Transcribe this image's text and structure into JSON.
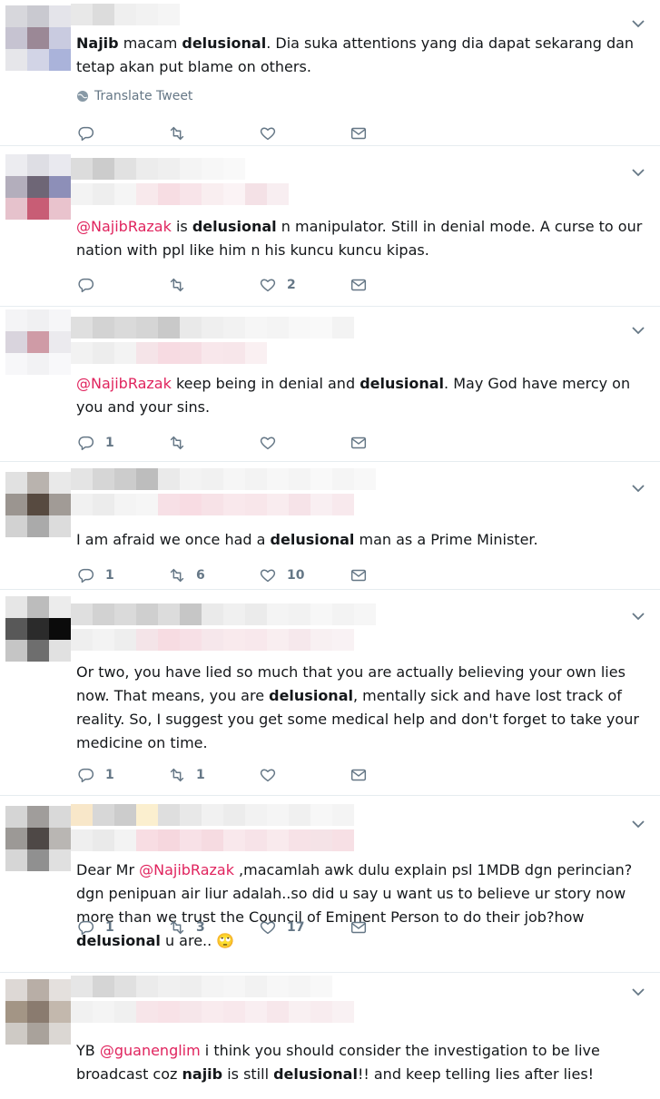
{
  "translate_label": "Translate Tweet",
  "colors": {
    "mention": "#e0245e",
    "icon": "#657786",
    "text": "#14171a"
  },
  "icons": {
    "reply": "reply-icon",
    "retweet": "retweet-icon",
    "like": "heart-icon",
    "dm": "envelope-icon",
    "menu": "chevron-down-icon",
    "translate": "globe-icon"
  },
  "tweets": [
    {
      "parts": [
        {
          "t": "Najib",
          "style": "b"
        },
        {
          "t": " macam "
        },
        {
          "t": "delusional",
          "style": "b"
        },
        {
          "t": ". Dia suka attentions yang dia dapat sekarang dan tetap akan put blame on others."
        }
      ],
      "replies": "",
      "retweets": "",
      "likes": ""
    },
    {
      "parts": [
        {
          "t": "@NajibRazak",
          "style": "m"
        },
        {
          "t": " is "
        },
        {
          "t": "delusional",
          "style": "b"
        },
        {
          "t": " n manipulator. Still in denial mode. A curse to our nation with ppl like him n his kuncu kuncu kipas."
        }
      ],
      "replies": "",
      "retweets": "",
      "likes": "2"
    },
    {
      "parts": [
        {
          "t": "@NajibRazak",
          "style": "m"
        },
        {
          "t": " keep being in denial and "
        },
        {
          "t": "delusional",
          "style": "b"
        },
        {
          "t": ". May God have mercy on you and your sins."
        }
      ],
      "replies": "1",
      "retweets": "",
      "likes": ""
    },
    {
      "parts": [
        {
          "t": "I am afraid we once had a "
        },
        {
          "t": "delusional",
          "style": "b"
        },
        {
          "t": " man as a Prime Minister."
        }
      ],
      "replies": "1",
      "retweets": "6",
      "likes": "10"
    },
    {
      "parts": [
        {
          "t": "Or two, you have lied so much that you are actually believing your own lies now. That means, you are "
        },
        {
          "t": "delusional",
          "style": "b"
        },
        {
          "t": ", mentally sick and have lost track of reality. So, I suggest you get some medical help and don't forget to take your medicine on time."
        }
      ],
      "replies": "1",
      "retweets": "1",
      "likes": ""
    },
    {
      "parts": [
        {
          "t": "Dear Mr "
        },
        {
          "t": "@NajibRazak",
          "style": "m"
        },
        {
          "t": " ,macamlah awk dulu explain psl 1MDB dgn perincian?dgn penipuan air liur adalah..so did u say u want us to believe ur story now more than we trust the Council of Eminent Person to do their job?how "
        },
        {
          "t": "delusional",
          "style": "b"
        },
        {
          "t": " u are.. 🙄"
        }
      ],
      "replies": "1",
      "retweets": "3",
      "likes": "17"
    },
    {
      "parts": [
        {
          "t": "YB "
        },
        {
          "t": "@guanenglim",
          "style": "m"
        },
        {
          "t": " i think you should consider the investigation to be live broadcast coz "
        },
        {
          "t": "najib",
          "style": "b"
        },
        {
          "t": " is still "
        },
        {
          "t": "delusional",
          "style": "b"
        },
        {
          "t": "!! and keep telling lies after lies!"
        }
      ],
      "replies": "",
      "retweets": "",
      "likes": ""
    }
  ]
}
